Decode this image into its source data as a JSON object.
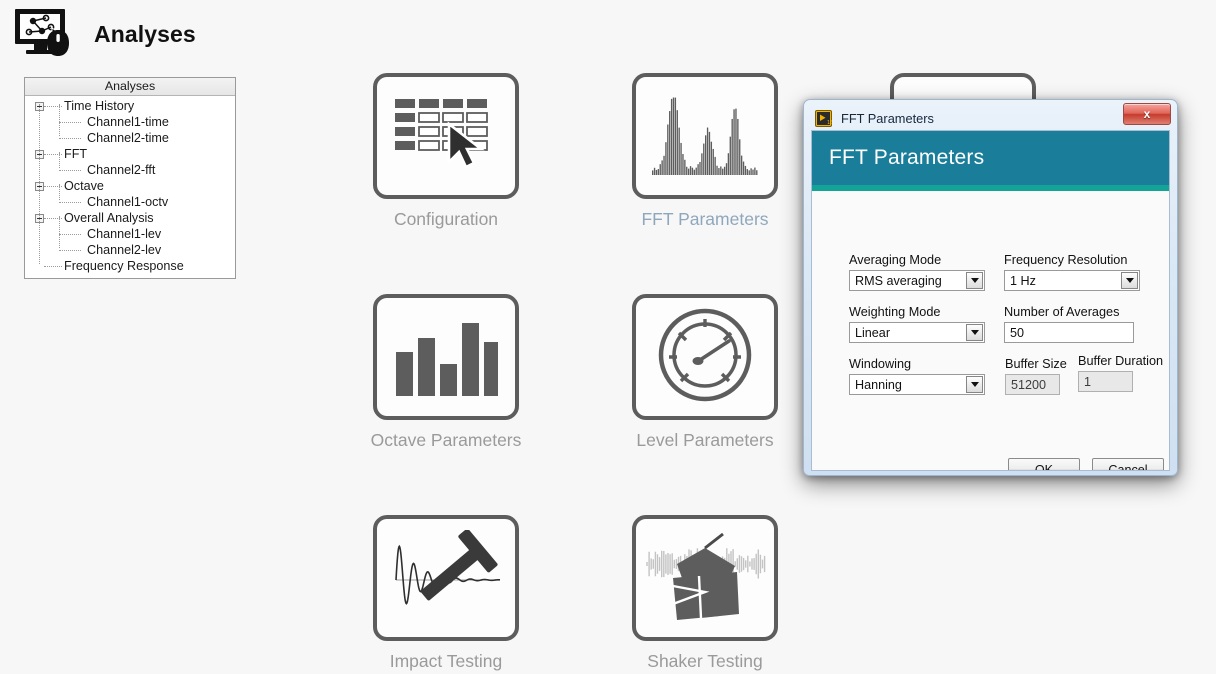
{
  "page": {
    "title": "Analyses",
    "app_icon": "monitor-graph-mouse-icon",
    "background_color": "#f7f7f7"
  },
  "tree": {
    "header": "Analyses",
    "nodes": [
      {
        "label": "Time History",
        "level": 0,
        "expandable": true,
        "expanded": true
      },
      {
        "label": "Channel1-time",
        "level": 1,
        "expandable": false,
        "expanded": false
      },
      {
        "label": "Channel2-time",
        "level": 1,
        "expandable": false,
        "expanded": false
      },
      {
        "label": "FFT",
        "level": 0,
        "expandable": true,
        "expanded": true
      },
      {
        "label": "Channel2-fft",
        "level": 1,
        "expandable": false,
        "expanded": false
      },
      {
        "label": "Octave",
        "level": 0,
        "expandable": true,
        "expanded": true
      },
      {
        "label": "Channel1-octv",
        "level": 1,
        "expandable": false,
        "expanded": false
      },
      {
        "label": "Overall Analysis",
        "level": 0,
        "expandable": true,
        "expanded": true
      },
      {
        "label": "Channel1-lev",
        "level": 1,
        "expandable": false,
        "expanded": false
      },
      {
        "label": "Channel2-lev",
        "level": 1,
        "expandable": false,
        "expanded": false
      },
      {
        "label": "Frequency Response",
        "level": 0,
        "expandable": false,
        "expanded": false
      }
    ]
  },
  "tiles": [
    {
      "label": "Configuration",
      "icon": "table-cursor-icon",
      "highlighted": false
    },
    {
      "label": "FFT Parameters",
      "icon": "spectrum-icon",
      "highlighted": true
    },
    {
      "label": "Octave Parameters",
      "icon": "bar-chart-icon",
      "highlighted": false
    },
    {
      "label": "Level Parameters",
      "icon": "gauge-icon",
      "highlighted": false
    },
    {
      "label": "Impact Testing",
      "icon": "hammer-decay-icon",
      "highlighted": false
    },
    {
      "label": "Shaker Testing",
      "icon": "shaker-noise-icon",
      "highlighted": false
    }
  ],
  "dialog": {
    "window_title": "FFT Parameters",
    "window_icon": "labview-vi-icon",
    "close_label": "x",
    "banner_title": "FFT Parameters",
    "banner_color": "#1a7e9a",
    "banner_accent_color": "#14a497",
    "fields": {
      "averaging_mode": {
        "label": "Averaging Mode",
        "value": "RMS averaging",
        "type": "dropdown"
      },
      "frequency_resolution": {
        "label": "Frequency Resolution",
        "value": "1 Hz",
        "type": "dropdown"
      },
      "weighting_mode": {
        "label": "Weighting Mode",
        "value": "Linear",
        "type": "dropdown"
      },
      "number_of_averages": {
        "label": "Number of Averages",
        "value": "50",
        "type": "text"
      },
      "windowing": {
        "label": "Windowing",
        "value": "Hanning",
        "type": "dropdown"
      },
      "buffer_size": {
        "label": "Buffer Size",
        "value": "51200",
        "type": "text-readonly"
      },
      "buffer_duration": {
        "label": "Buffer Duration",
        "value": "1",
        "type": "text-readonly"
      }
    },
    "buttons": {
      "ok": "OK",
      "cancel": "Cancel"
    }
  }
}
